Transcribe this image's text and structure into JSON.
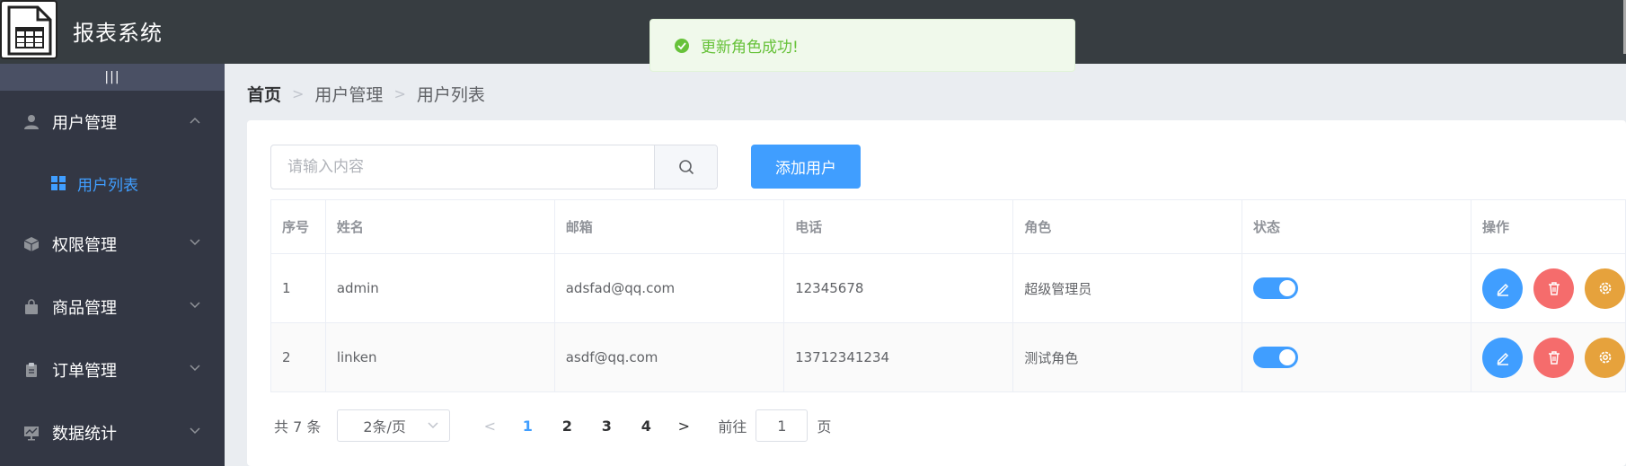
{
  "header": {
    "title": "报表系统"
  },
  "sidebar": {
    "toggle_label": "|||",
    "menus": [
      {
        "label": "用户管理",
        "icon": "user-icon",
        "expanded": true
      },
      {
        "label": "权限管理",
        "icon": "box-icon",
        "expanded": false
      },
      {
        "label": "商品管理",
        "icon": "bag-icon",
        "expanded": false
      },
      {
        "label": "订单管理",
        "icon": "clipboard-icon",
        "expanded": false
      },
      {
        "label": "数据统计",
        "icon": "chart-icon",
        "expanded": false
      }
    ],
    "sub_item": {
      "label": "用户列表",
      "icon": "grid-icon"
    }
  },
  "breadcrumb": {
    "home": "首页",
    "level1": "用户管理",
    "level2": "用户列表"
  },
  "search": {
    "placeholder": "请输入内容",
    "value": ""
  },
  "add_button": "添加用户",
  "table": {
    "headers": [
      "序号",
      "姓名",
      "邮箱",
      "电话",
      "角色",
      "状态",
      "操作"
    ],
    "rows": [
      {
        "index": "1",
        "name": "admin",
        "email": "adsfad@qq.com",
        "phone": "12345678",
        "role": "超级管理员",
        "status": true
      },
      {
        "index": "2",
        "name": "linken",
        "email": "asdf@qq.com",
        "phone": "13712341234",
        "role": "测试角色",
        "status": true
      }
    ]
  },
  "pagination": {
    "total_text": "共 7 条",
    "page_size": "2条/页",
    "pages": [
      "1",
      "2",
      "3",
      "4"
    ],
    "current_page": "1",
    "goto_prefix": "前往",
    "goto_value": "1",
    "goto_suffix": "页"
  },
  "toast": {
    "message": "更新角色成功!",
    "type": "success"
  },
  "colors": {
    "header_bg": "#373d41",
    "sidebar_bg": "#333744",
    "primary": "#409eff",
    "danger": "#f56c6c",
    "warning": "#e6a23c",
    "success": "#67c23a"
  }
}
